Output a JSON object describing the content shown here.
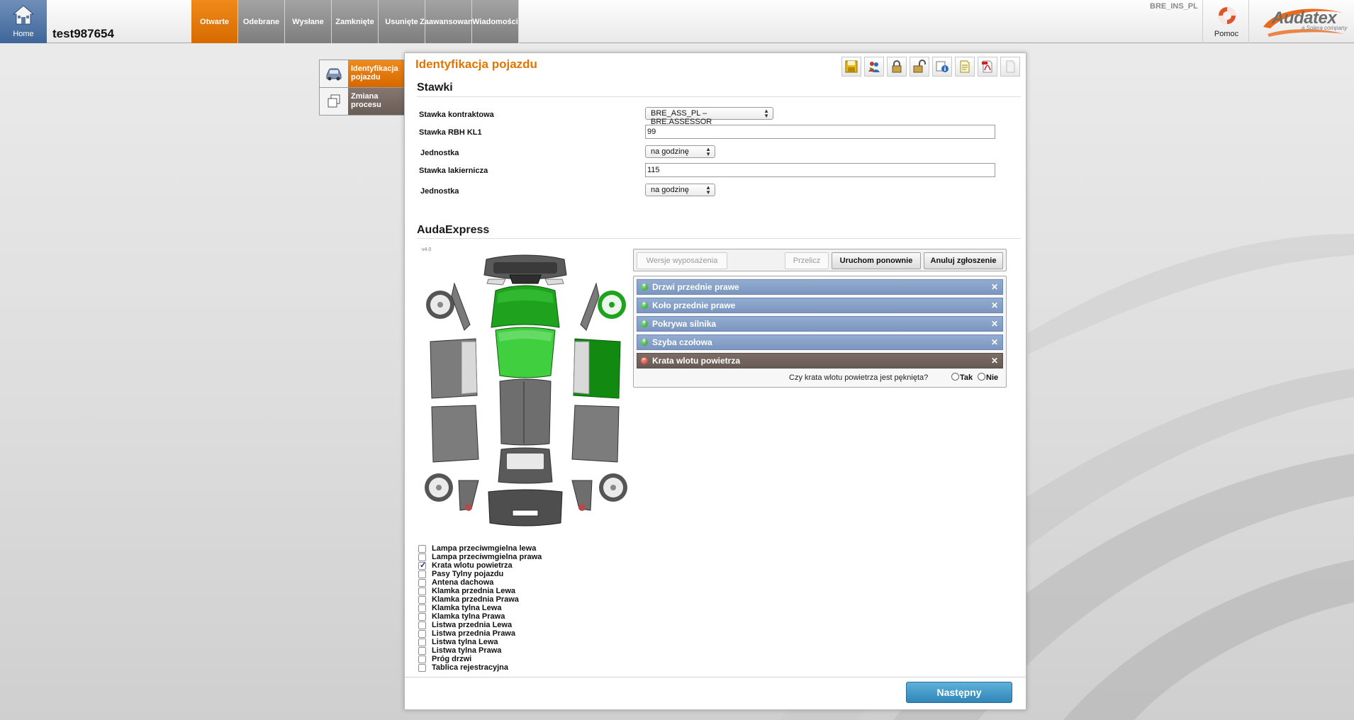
{
  "header": {
    "home_label": "Home",
    "case_id": "test987654",
    "tabs": [
      {
        "label": "Otwarte",
        "active": true
      },
      {
        "label": "Odebrane",
        "active": false
      },
      {
        "label": "Wysłane",
        "active": false
      },
      {
        "label": "Zamknięte",
        "active": false
      },
      {
        "label": "Usunięte",
        "active": false
      },
      {
        "label": "Zaawansowane",
        "active": false
      },
      {
        "label": "Wiadomości",
        "active": false
      }
    ],
    "env_label": "BRE_INS_PL",
    "help_label": "Pomoc",
    "logo_text": "Audatex",
    "logo_sub": "a Solera company"
  },
  "steps": [
    {
      "label": "Identyfikacja pojazdu",
      "active": true,
      "icon": "car-icon"
    },
    {
      "label": "Zmiana procesu",
      "active": false,
      "icon": "copy-pages-icon"
    }
  ],
  "panel": {
    "title": "Identyfikacja pojazdu",
    "toolbar_icons": [
      "save-icon",
      "users-icon",
      "lock-closed-icon",
      "lock-open-icon",
      "info-icon",
      "notes-icon",
      "pdf-icon",
      "blank-page-icon"
    ]
  },
  "rates": {
    "heading": "Stawki",
    "contract_rate_label": "Stawka kontraktowa",
    "contract_rate_value": "BRE_ASS_PL – BRE.ASSESSOR",
    "rbh_label": "Stawka RBH KL1",
    "rbh_value": "99",
    "unit1_label": "Jednostka",
    "unit1_value": "na godzinę",
    "paint_label": "Stawka lakiernicza",
    "paint_value": "115",
    "unit2_label": "Jednostka",
    "unit2_value": "na godzinę"
  },
  "audaexpress": {
    "heading": "AudaExpress",
    "version": "v4.0",
    "buttons": {
      "equipment": "Wersje wyposażenia",
      "recalc": "Przelicz",
      "restart": "Uruchom ponownie",
      "cancel": "Anuluj zgłoszenie"
    },
    "parts": [
      {
        "name": "Drzwi przednie prawe",
        "state": "added"
      },
      {
        "name": "Koło przednie prawe",
        "state": "added"
      },
      {
        "name": "Pokrywa silnika",
        "state": "added"
      },
      {
        "name": "Szyba czołowa",
        "state": "added"
      },
      {
        "name": "Krata wlotu powietrza",
        "state": "active"
      }
    ],
    "question": "Czy krata wlotu powietrza jest pęknięta?",
    "answer_yes": "Tak",
    "answer_no": "Nie",
    "checklist": [
      {
        "label": "Lampa przeciwmgielna lewa",
        "checked": false
      },
      {
        "label": "Lampa przeciwmgielna prawa",
        "checked": false
      },
      {
        "label": "Krata wlotu powietrza",
        "checked": true
      },
      {
        "label": "Pasy Tylny pojazdu",
        "checked": false
      },
      {
        "label": "Antena dachowa",
        "checked": false
      },
      {
        "label": "Klamka przednia Lewa",
        "checked": false
      },
      {
        "label": "Klamka przednia Prawa",
        "checked": false
      },
      {
        "label": "Klamka tylna Lewa",
        "checked": false
      },
      {
        "label": "Klamka tylna Prawa",
        "checked": false
      },
      {
        "label": "Listwa przednia Lewa",
        "checked": false
      },
      {
        "label": "Listwa przednia Prawa",
        "checked": false
      },
      {
        "label": "Listwa tylna Lewa",
        "checked": false
      },
      {
        "label": "Listwa tylna Prawa",
        "checked": false
      },
      {
        "label": "Próg drzwi",
        "checked": false
      },
      {
        "label": "Tablica rejestracyjna",
        "checked": false
      }
    ]
  },
  "footer": {
    "next_label": "Następny"
  },
  "colors": {
    "accent": "#e27400",
    "part_bar": "#7b96bf",
    "part_active": "#675a55",
    "selected_green": "#1fa31f",
    "next_button": "#2f86b8"
  }
}
